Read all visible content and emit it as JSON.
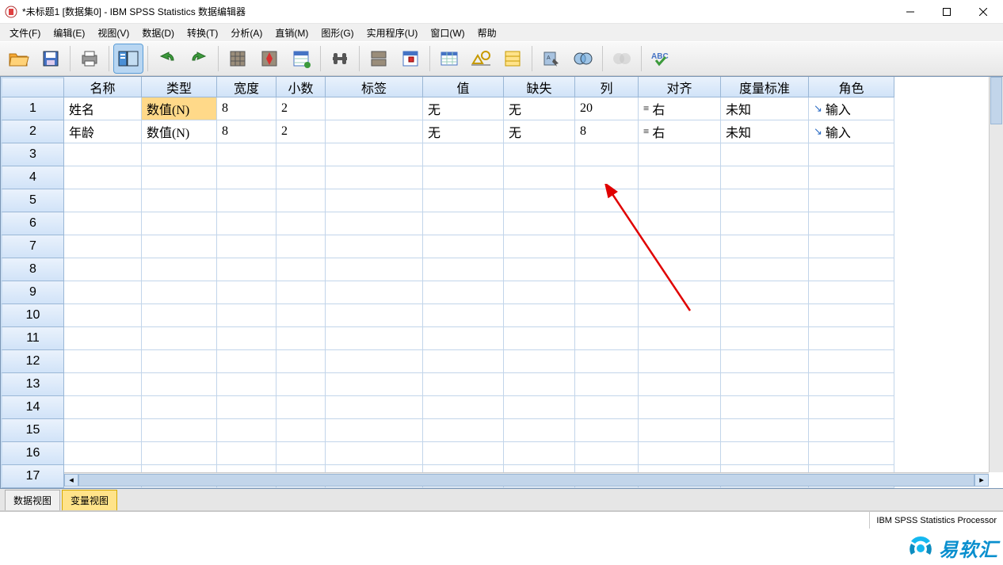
{
  "window": {
    "title": "*未标题1 [数据集0] - IBM SPSS Statistics 数据编辑器"
  },
  "menus": [
    "文件(F)",
    "编辑(E)",
    "视图(V)",
    "数据(D)",
    "转换(T)",
    "分析(A)",
    "直销(M)",
    "图形(G)",
    "实用程序(U)",
    "窗口(W)",
    "帮助"
  ],
  "columns": {
    "name": "名称",
    "type": "类型",
    "width": "宽度",
    "decimals": "小数",
    "label": "标签",
    "values": "值",
    "missing": "缺失",
    "cols": "列",
    "align": "对齐",
    "measure": "度量标准",
    "role": "角色"
  },
  "rows": [
    {
      "num": "1",
      "name": "姓名",
      "type": "数值(N)",
      "width": "8",
      "decimals": "2",
      "label": "",
      "values": "无",
      "missing": "无",
      "cols": "20",
      "align": "右",
      "measure": "未知",
      "role": "输入",
      "type_sel": true
    },
    {
      "num": "2",
      "name": "年龄",
      "type": "数值(N)",
      "width": "8",
      "decimals": "2",
      "label": "",
      "values": "无",
      "missing": "无",
      "cols": "8",
      "align": "右",
      "measure": "未知",
      "role": "输入",
      "type_sel": false
    }
  ],
  "empty_rows": [
    "3",
    "4",
    "5",
    "6",
    "7",
    "8",
    "9",
    "10",
    "11",
    "12",
    "13",
    "14",
    "15",
    "16",
    "17"
  ],
  "tabs": {
    "data_view": "数据视图",
    "var_view": "变量视图"
  },
  "status": {
    "processor": "IBM SPSS Statistics Processor"
  },
  "brand": "易软汇"
}
